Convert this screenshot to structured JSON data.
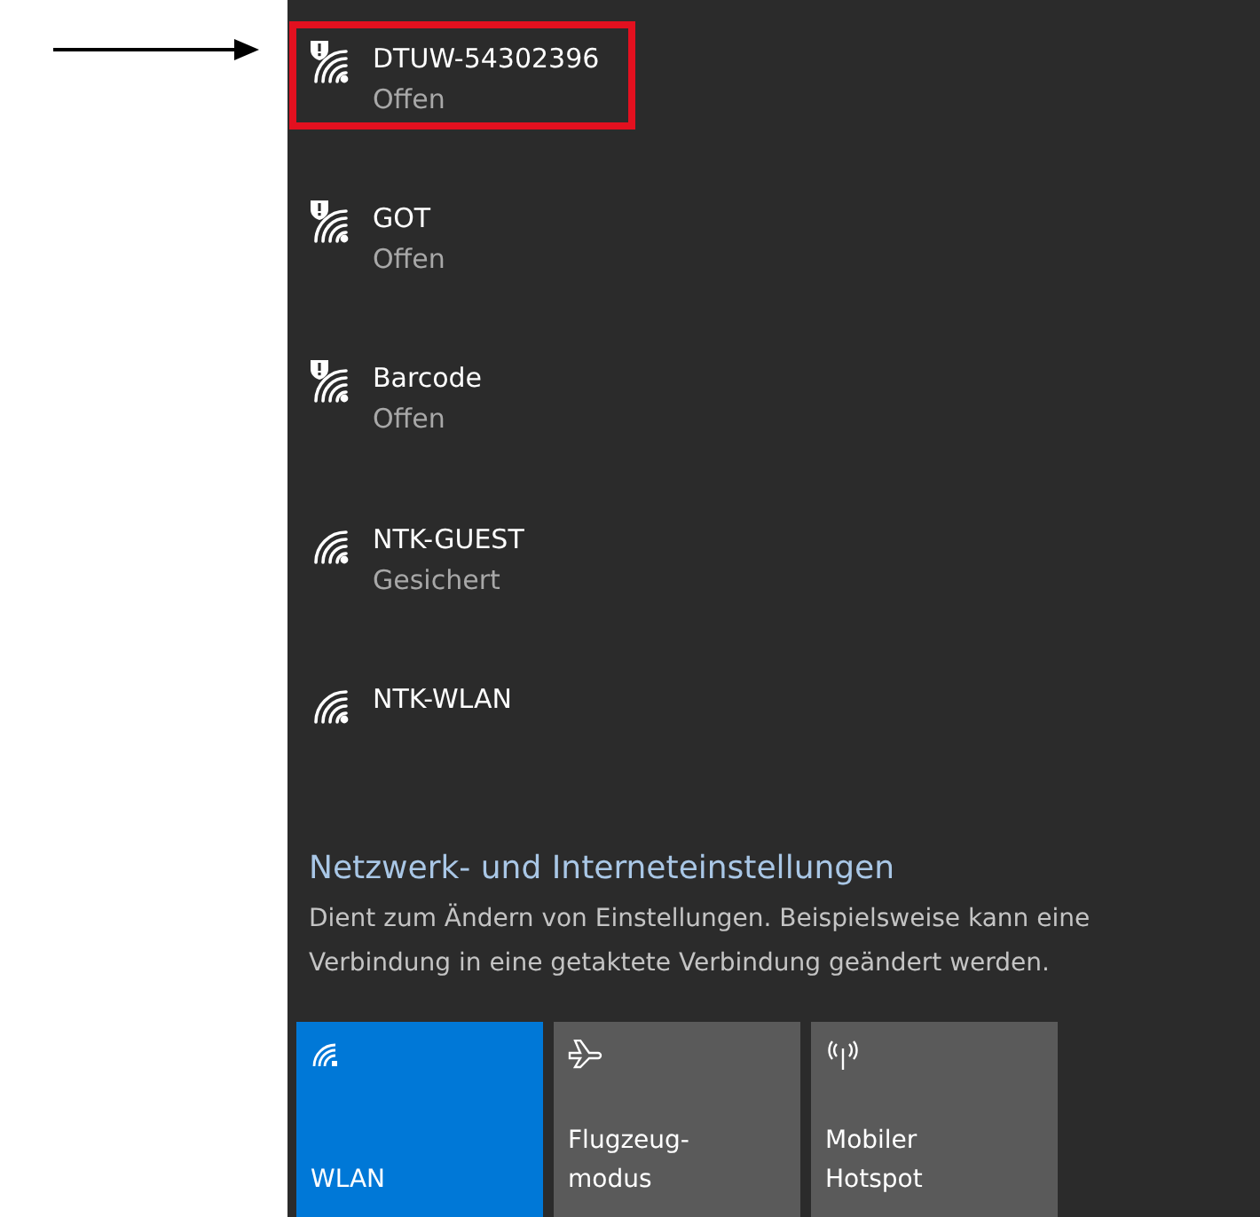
{
  "networks": [
    {
      "name": "DTUW-54302396",
      "status": "Offen",
      "unsecured": true,
      "highlighted": true
    },
    {
      "name": "GOT",
      "status": "Offen",
      "unsecured": true,
      "highlighted": false
    },
    {
      "name": "Barcode",
      "status": "Offen",
      "unsecured": true,
      "highlighted": false
    },
    {
      "name": "NTK-GUEST",
      "status": "Gesichert",
      "unsecured": false,
      "highlighted": false
    },
    {
      "name": "NTK-WLAN",
      "unsecured": false,
      "highlighted": false
    }
  ],
  "settings": {
    "title": "Netzwerk- und Interneteinstellungen",
    "description": "Dient zum Ändern von Einstellungen. Beispielsweise kann eine Verbindung in eine getaktete Verbindung geändert werden."
  },
  "tiles": [
    {
      "kind": "wifi",
      "label": "WLAN",
      "selected": true
    },
    {
      "kind": "airplane",
      "label": "Flugzeug-\nmodus",
      "selected": false
    },
    {
      "kind": "hotspot",
      "label": "Mobiler\nHotspot",
      "selected": false
    }
  ]
}
